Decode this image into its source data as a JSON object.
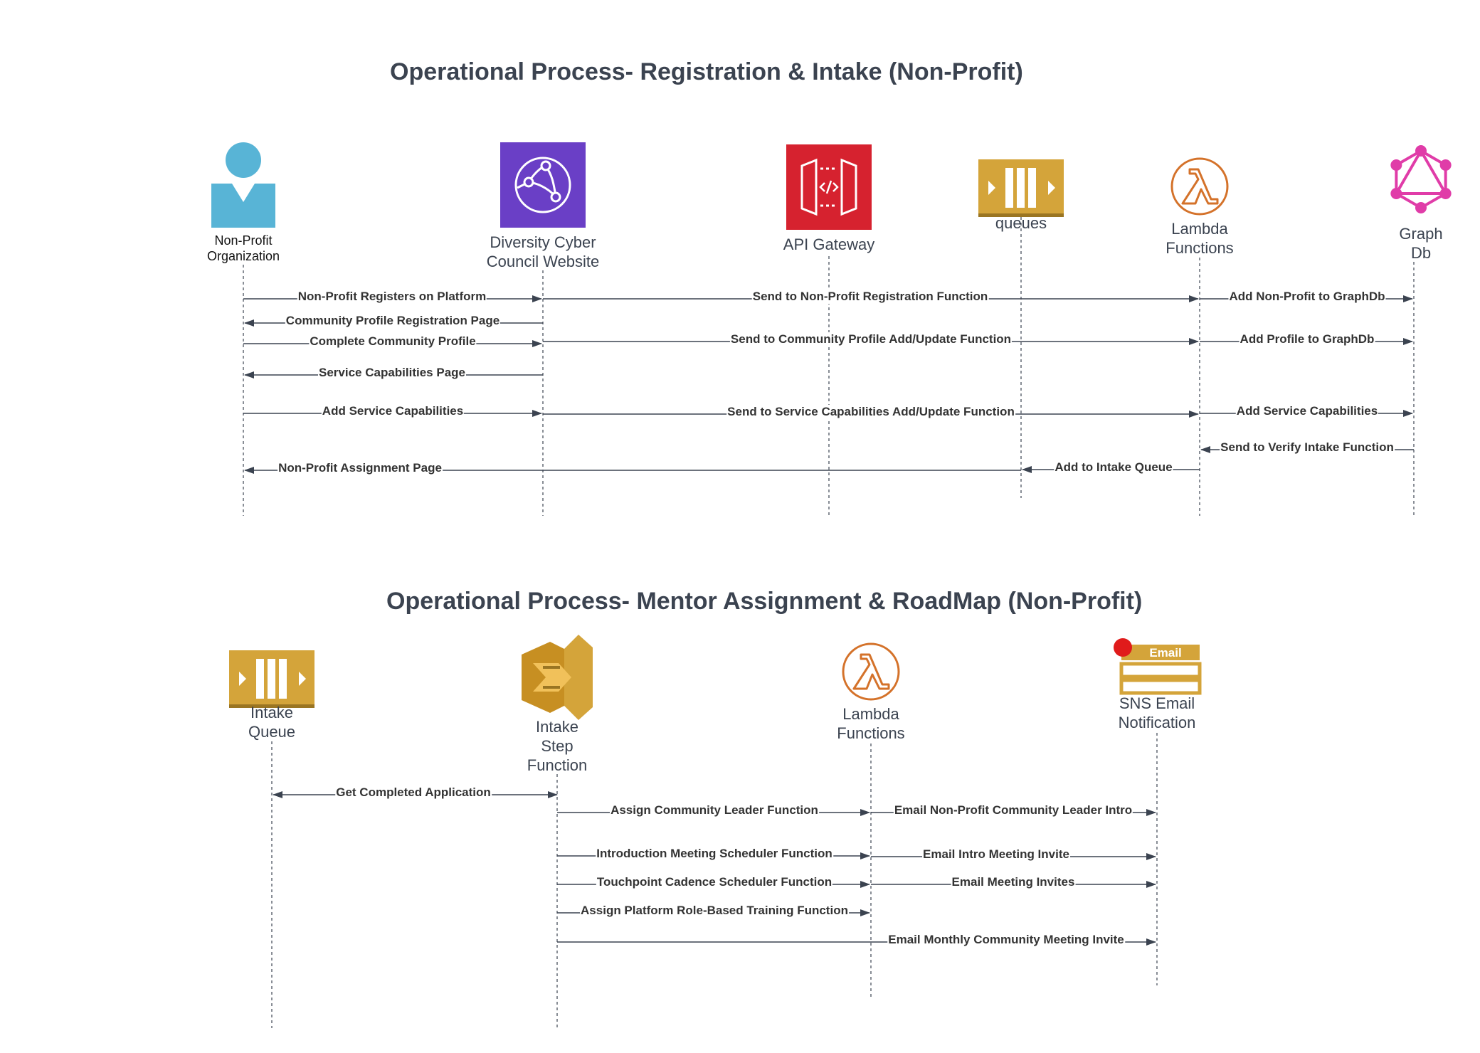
{
  "section1": {
    "title": "Operational Process- Registration & Intake (Non-Profit)",
    "actors": [
      {
        "id": "np",
        "label": [
          "Non-Profit",
          "Organization"
        ],
        "icon": "person-icon"
      },
      {
        "id": "web",
        "label": [
          "Diversity Cyber",
          "Council Website"
        ],
        "icon": "cloudfront-icon"
      },
      {
        "id": "api",
        "label": [
          "API Gateway"
        ],
        "icon": "api-gateway-icon"
      },
      {
        "id": "q",
        "label": [
          "queues"
        ],
        "icon": "sqs-queue-icon"
      },
      {
        "id": "lam",
        "label": [
          "Lambda",
          "Functions"
        ],
        "icon": "lambda-icon"
      },
      {
        "id": "gdb",
        "label": [
          "Graph",
          "Db"
        ],
        "icon": "graphql-icon"
      }
    ],
    "messages": [
      {
        "label": "Non-Profit Registers on Platform",
        "from": "np",
        "to": "web"
      },
      {
        "label": "Send to Non-Profit Registration Function",
        "from": "web",
        "to": "lam"
      },
      {
        "label": "Add Non-Profit to GraphDb",
        "from": "lam",
        "to": "gdb"
      },
      {
        "label": "Community Profile Registration Page",
        "from": "web",
        "to": "np"
      },
      {
        "label": "Complete Community Profile",
        "from": "np",
        "to": "web"
      },
      {
        "label": "Send to Community Profile Add/Update Function",
        "from": "web",
        "to": "lam"
      },
      {
        "label": "Add Profile to GraphDb",
        "from": "lam",
        "to": "gdb"
      },
      {
        "label": "Service Capabilities Page",
        "from": "web",
        "to": "np"
      },
      {
        "label": "Add Service Capabilities",
        "from": "np",
        "to": "web"
      },
      {
        "label": "Send to Service Capabilities Add/Update Function",
        "from": "web",
        "to": "lam"
      },
      {
        "label": "Add Service Capabilities",
        "from": "lam",
        "to": "gdb"
      },
      {
        "label": "Send to Verify Intake Function",
        "from": "gdb",
        "to": "lam"
      },
      {
        "label": "Add to Intake Queue",
        "from": "lam",
        "to": "q"
      },
      {
        "label": "Non-Profit Assignment Page",
        "from": "q",
        "to": "np"
      }
    ]
  },
  "section2": {
    "title": "Operational Process- Mentor Assignment & RoadMap (Non-Profit)",
    "actors": [
      {
        "id": "iq",
        "label": [
          "Intake",
          "Queue"
        ],
        "icon": "sqs-queue-icon"
      },
      {
        "id": "sf",
        "label": [
          "Intake",
          "Step",
          "Function"
        ],
        "icon": "step-functions-icon"
      },
      {
        "id": "lam2",
        "label": [
          "Lambda",
          "Functions"
        ],
        "icon": "lambda-icon"
      },
      {
        "id": "sns",
        "label": [
          "SNS Email",
          "Notification"
        ],
        "icon": "sns-email-icon"
      }
    ],
    "icon_text": {
      "email": "Email"
    },
    "messages": [
      {
        "label": "Get Completed Application",
        "from": "sf",
        "to": "iq",
        "both": true
      },
      {
        "label": "Assign Community Leader Function",
        "from": "sf",
        "to": "lam2"
      },
      {
        "label": "Email Non-Profit Community Leader Intro",
        "from": "lam2",
        "to": "sns"
      },
      {
        "label": "Introduction Meeting Scheduler Function",
        "from": "sf",
        "to": "lam2"
      },
      {
        "label": "Email Intro Meeting Invite",
        "from": "lam2",
        "to": "sns"
      },
      {
        "label": "Touchpoint Cadence Scheduler Function",
        "from": "sf",
        "to": "lam2"
      },
      {
        "label": "Email Meeting Invites",
        "from": "lam2",
        "to": "sns"
      },
      {
        "label": "Assign Platform Role-Based Training Function",
        "from": "sf",
        "to": "lam2"
      },
      {
        "label": "Email Monthly Community Meeting Invite",
        "from": "sf",
        "to": "sns"
      }
    ]
  },
  "colors": {
    "line": "#3b4350",
    "text": "#3b4350",
    "person": "#58b4d6",
    "cloudfront": "#6a3fc6",
    "api_gateway": "#d6222f",
    "queue": "#d4a43a",
    "queue_dark": "#9a7522",
    "lambda": "#d4722a",
    "graphql": "#e03ca8",
    "step_functions": "#d4a43a",
    "notification_dot": "#e01b1b"
  }
}
